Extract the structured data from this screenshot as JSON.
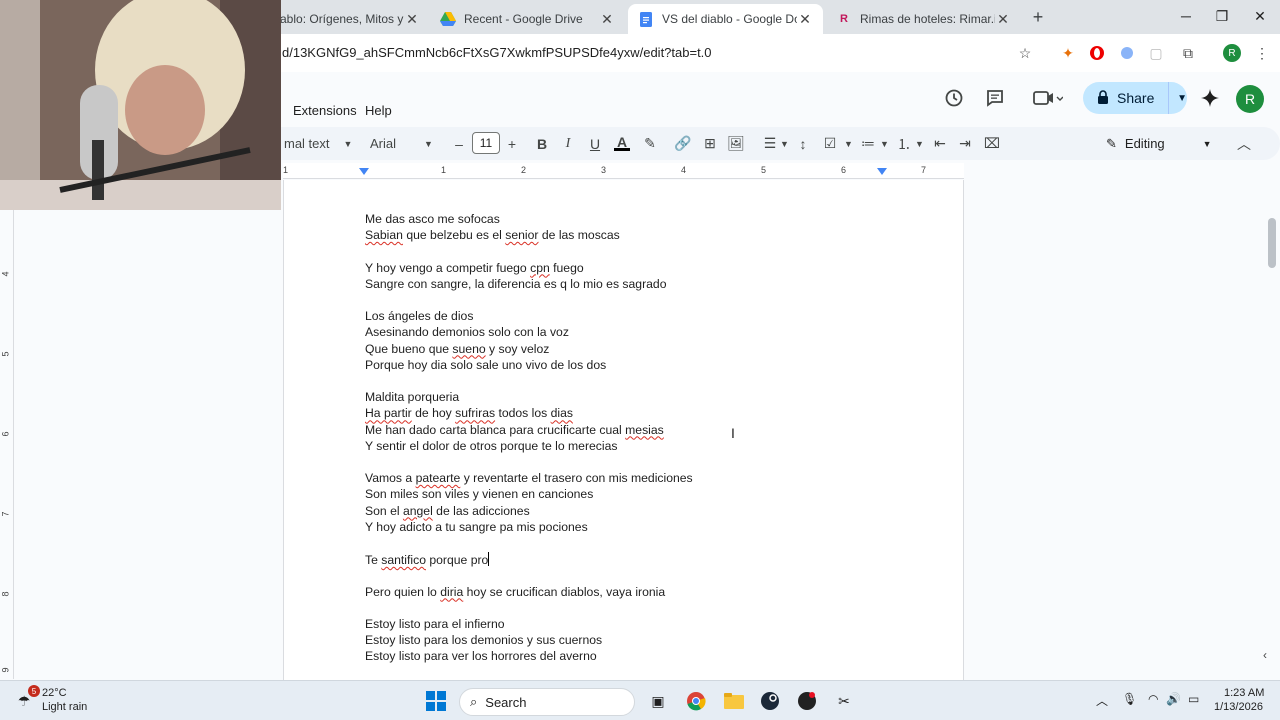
{
  "browser": {
    "tabs": [
      {
        "label": "ablo: Orígenes, Mitos y Cu",
        "active": false
      },
      {
        "label": "Recent - Google Drive",
        "active": false
      },
      {
        "label": "VS del diablo - Google Docs",
        "active": true
      },
      {
        "label": "Rimas de hoteles: Rimar.io",
        "active": false
      }
    ],
    "url": "d/13KGNfG9_ahSFCmmNcb6cFtXsG7XwkmfPSUPSDfe4yxw/edit?tab=t.0",
    "profile_initial": "R"
  },
  "docs": {
    "menu": [
      "Extensions",
      "Help"
    ],
    "share_label": "Share",
    "avatar_initial": "R",
    "toolbar": {
      "style": "mal text",
      "font": "Arial",
      "font_size": "11",
      "mode": "Editing"
    },
    "ruler_numbers": [
      "1",
      "1",
      "2",
      "3",
      "4",
      "5",
      "6",
      "7"
    ],
    "vruler_numbers": [
      "4",
      "5",
      "6",
      "7",
      "8",
      "9"
    ]
  },
  "document": {
    "lines": [
      [
        {
          "t": "Me das asco me sofocas"
        }
      ],
      [
        {
          "t": "Sabian",
          "s": true
        },
        {
          "t": " que belzebu es el "
        },
        {
          "t": "senior",
          "s": true
        },
        {
          "t": " de las moscas"
        }
      ],
      [],
      [
        {
          "t": "Y hoy vengo a competir fuego "
        },
        {
          "t": "cpn",
          "s": true
        },
        {
          "t": " fuego"
        }
      ],
      [
        {
          "t": "Sangre con sangre, la diferencia es q lo mio es sagrado"
        }
      ],
      [],
      [
        {
          "t": "Los ángeles de dios"
        }
      ],
      [
        {
          "t": "Asesinando demonios solo con la voz"
        }
      ],
      [
        {
          "t": "Que bueno que "
        },
        {
          "t": "sueno",
          "s": true
        },
        {
          "t": " y soy veloz"
        }
      ],
      [
        {
          "t": "Porque hoy dia solo sale uno vivo de los dos"
        }
      ],
      [],
      [
        {
          "t": "Maldita porqueria"
        }
      ],
      [
        {
          "t": "Ha partir",
          "s": true
        },
        {
          "t": " de hoy "
        },
        {
          "t": "sufriras",
          "s": true
        },
        {
          "t": " todos los "
        },
        {
          "t": "dias",
          "s": true
        }
      ],
      [
        {
          "t": "Me han dado carta blanca para crucificarte cual "
        },
        {
          "t": "mesias",
          "s": true
        }
      ],
      [
        {
          "t": "Y sentir el dolor de otros porque te lo merecias"
        }
      ],
      [],
      [
        {
          "t": "Vamos a "
        },
        {
          "t": "patearte",
          "s": true
        },
        {
          "t": " y reventarte el trasero con mis mediciones"
        }
      ],
      [
        {
          "t": "Son miles son viles y vienen en canciones"
        }
      ],
      [
        {
          "t": "Son el "
        },
        {
          "t": "angel",
          "s": true
        },
        {
          "t": " de las adicciones"
        }
      ],
      [
        {
          "t": "Y hoy adicto a tu sangre pa mis pociones"
        }
      ],
      [],
      [
        {
          "t": "Te "
        },
        {
          "t": "santifico",
          "s": true
        },
        {
          "t": " porque pro"
        },
        {
          "caret": true
        }
      ],
      [],
      [
        {
          "t": "Pero quien lo "
        },
        {
          "t": "diria",
          "s": true
        },
        {
          "t": " hoy se crucifican diablos, vaya ironia"
        }
      ],
      [],
      [
        {
          "t": "Estoy listo para el infierno"
        }
      ],
      [
        {
          "t": "Estoy listo para los demonios y sus cuernos"
        }
      ],
      [
        {
          "t": "Estoy listo para ver los horrores del averno"
        }
      ]
    ]
  },
  "taskbar": {
    "weather_temp": "22°C",
    "weather_desc": "Light rain",
    "weather_badge": "5",
    "search_label": "Search",
    "time": "1:23 AM",
    "date": "1/13/2026"
  }
}
